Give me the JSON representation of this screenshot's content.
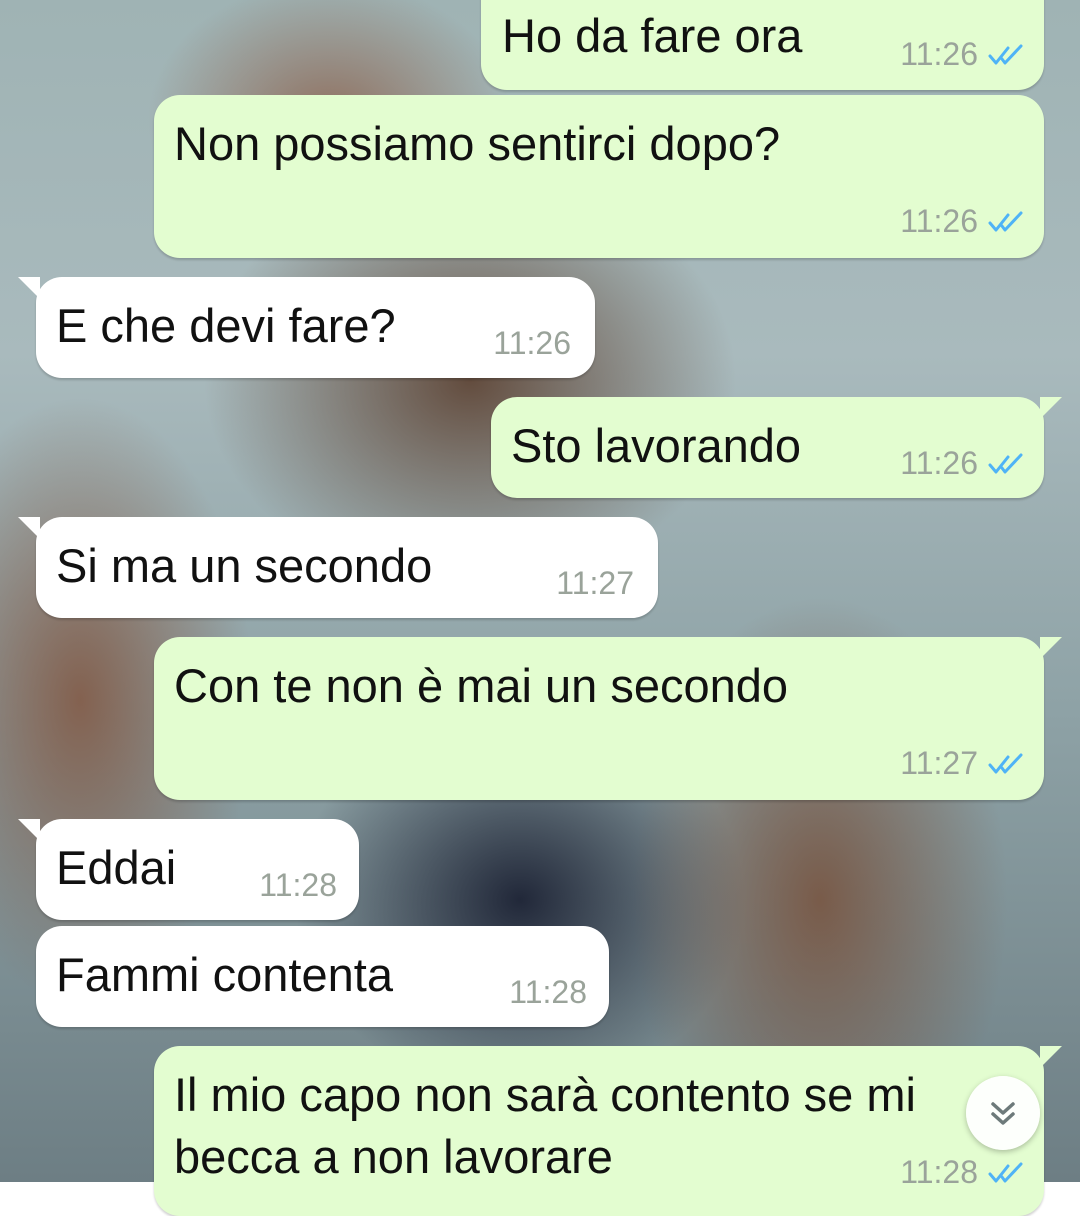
{
  "conversation": {
    "messages": [
      {
        "direction": "outgoing",
        "text": "Ho da fare ora",
        "time": "11:26",
        "status": "read"
      },
      {
        "direction": "outgoing",
        "text": "Non possiamo sentirci dopo?",
        "time": "11:26",
        "status": "read"
      },
      {
        "direction": "incoming",
        "text": "E che devi fare?",
        "time": "11:26"
      },
      {
        "direction": "outgoing",
        "text": "Sto lavorando",
        "time": "11:26",
        "status": "read"
      },
      {
        "direction": "incoming",
        "text": "Si ma un secondo",
        "time": "11:27"
      },
      {
        "direction": "outgoing",
        "text": "Con te non è mai un secondo",
        "time": "11:27",
        "status": "read"
      },
      {
        "direction": "incoming",
        "text": "Eddai",
        "time": "11:28"
      },
      {
        "direction": "incoming",
        "text": "Fammi contenta",
        "time": "11:28"
      },
      {
        "direction": "outgoing",
        "text_lines": [
          "Il mio capo non sarà contento se mi",
          "becca a non lavorare"
        ],
        "time": "11:28",
        "status": "read"
      }
    ]
  },
  "icons": {
    "read_receipt": "double-check-icon",
    "scroll_down": "chevron-double-down-icon"
  },
  "colors": {
    "outgoing_bubble": "#e3fdd0",
    "incoming_bubble": "#ffffff",
    "read_tick": "#4fb3f6",
    "timestamp": "#9aa39a"
  }
}
